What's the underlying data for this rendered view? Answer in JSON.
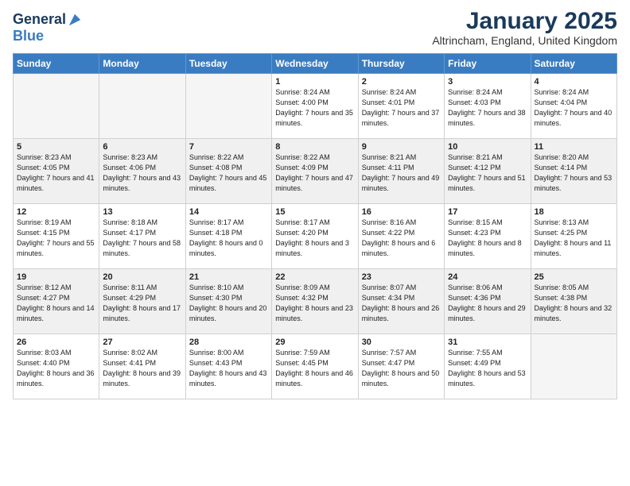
{
  "header": {
    "logo_general": "General",
    "logo_blue": "Blue",
    "month_title": "January 2025",
    "location": "Altrincham, England, United Kingdom"
  },
  "days_of_week": [
    "Sunday",
    "Monday",
    "Tuesday",
    "Wednesday",
    "Thursday",
    "Friday",
    "Saturday"
  ],
  "weeks": [
    [
      {
        "day": "",
        "sunrise": "",
        "sunset": "",
        "daylight": ""
      },
      {
        "day": "",
        "sunrise": "",
        "sunset": "",
        "daylight": ""
      },
      {
        "day": "",
        "sunrise": "",
        "sunset": "",
        "daylight": ""
      },
      {
        "day": "1",
        "sunrise": "Sunrise: 8:24 AM",
        "sunset": "Sunset: 4:00 PM",
        "daylight": "Daylight: 7 hours and 35 minutes."
      },
      {
        "day": "2",
        "sunrise": "Sunrise: 8:24 AM",
        "sunset": "Sunset: 4:01 PM",
        "daylight": "Daylight: 7 hours and 37 minutes."
      },
      {
        "day": "3",
        "sunrise": "Sunrise: 8:24 AM",
        "sunset": "Sunset: 4:03 PM",
        "daylight": "Daylight: 7 hours and 38 minutes."
      },
      {
        "day": "4",
        "sunrise": "Sunrise: 8:24 AM",
        "sunset": "Sunset: 4:04 PM",
        "daylight": "Daylight: 7 hours and 40 minutes."
      }
    ],
    [
      {
        "day": "5",
        "sunrise": "Sunrise: 8:23 AM",
        "sunset": "Sunset: 4:05 PM",
        "daylight": "Daylight: 7 hours and 41 minutes."
      },
      {
        "day": "6",
        "sunrise": "Sunrise: 8:23 AM",
        "sunset": "Sunset: 4:06 PM",
        "daylight": "Daylight: 7 hours and 43 minutes."
      },
      {
        "day": "7",
        "sunrise": "Sunrise: 8:22 AM",
        "sunset": "Sunset: 4:08 PM",
        "daylight": "Daylight: 7 hours and 45 minutes."
      },
      {
        "day": "8",
        "sunrise": "Sunrise: 8:22 AM",
        "sunset": "Sunset: 4:09 PM",
        "daylight": "Daylight: 7 hours and 47 minutes."
      },
      {
        "day": "9",
        "sunrise": "Sunrise: 8:21 AM",
        "sunset": "Sunset: 4:11 PM",
        "daylight": "Daylight: 7 hours and 49 minutes."
      },
      {
        "day": "10",
        "sunrise": "Sunrise: 8:21 AM",
        "sunset": "Sunset: 4:12 PM",
        "daylight": "Daylight: 7 hours and 51 minutes."
      },
      {
        "day": "11",
        "sunrise": "Sunrise: 8:20 AM",
        "sunset": "Sunset: 4:14 PM",
        "daylight": "Daylight: 7 hours and 53 minutes."
      }
    ],
    [
      {
        "day": "12",
        "sunrise": "Sunrise: 8:19 AM",
        "sunset": "Sunset: 4:15 PM",
        "daylight": "Daylight: 7 hours and 55 minutes."
      },
      {
        "day": "13",
        "sunrise": "Sunrise: 8:18 AM",
        "sunset": "Sunset: 4:17 PM",
        "daylight": "Daylight: 7 hours and 58 minutes."
      },
      {
        "day": "14",
        "sunrise": "Sunrise: 8:17 AM",
        "sunset": "Sunset: 4:18 PM",
        "daylight": "Daylight: 8 hours and 0 minutes."
      },
      {
        "day": "15",
        "sunrise": "Sunrise: 8:17 AM",
        "sunset": "Sunset: 4:20 PM",
        "daylight": "Daylight: 8 hours and 3 minutes."
      },
      {
        "day": "16",
        "sunrise": "Sunrise: 8:16 AM",
        "sunset": "Sunset: 4:22 PM",
        "daylight": "Daylight: 8 hours and 6 minutes."
      },
      {
        "day": "17",
        "sunrise": "Sunrise: 8:15 AM",
        "sunset": "Sunset: 4:23 PM",
        "daylight": "Daylight: 8 hours and 8 minutes."
      },
      {
        "day": "18",
        "sunrise": "Sunrise: 8:13 AM",
        "sunset": "Sunset: 4:25 PM",
        "daylight": "Daylight: 8 hours and 11 minutes."
      }
    ],
    [
      {
        "day": "19",
        "sunrise": "Sunrise: 8:12 AM",
        "sunset": "Sunset: 4:27 PM",
        "daylight": "Daylight: 8 hours and 14 minutes."
      },
      {
        "day": "20",
        "sunrise": "Sunrise: 8:11 AM",
        "sunset": "Sunset: 4:29 PM",
        "daylight": "Daylight: 8 hours and 17 minutes."
      },
      {
        "day": "21",
        "sunrise": "Sunrise: 8:10 AM",
        "sunset": "Sunset: 4:30 PM",
        "daylight": "Daylight: 8 hours and 20 minutes."
      },
      {
        "day": "22",
        "sunrise": "Sunrise: 8:09 AM",
        "sunset": "Sunset: 4:32 PM",
        "daylight": "Daylight: 8 hours and 23 minutes."
      },
      {
        "day": "23",
        "sunrise": "Sunrise: 8:07 AM",
        "sunset": "Sunset: 4:34 PM",
        "daylight": "Daylight: 8 hours and 26 minutes."
      },
      {
        "day": "24",
        "sunrise": "Sunrise: 8:06 AM",
        "sunset": "Sunset: 4:36 PM",
        "daylight": "Daylight: 8 hours and 29 minutes."
      },
      {
        "day": "25",
        "sunrise": "Sunrise: 8:05 AM",
        "sunset": "Sunset: 4:38 PM",
        "daylight": "Daylight: 8 hours and 32 minutes."
      }
    ],
    [
      {
        "day": "26",
        "sunrise": "Sunrise: 8:03 AM",
        "sunset": "Sunset: 4:40 PM",
        "daylight": "Daylight: 8 hours and 36 minutes."
      },
      {
        "day": "27",
        "sunrise": "Sunrise: 8:02 AM",
        "sunset": "Sunset: 4:41 PM",
        "daylight": "Daylight: 8 hours and 39 minutes."
      },
      {
        "day": "28",
        "sunrise": "Sunrise: 8:00 AM",
        "sunset": "Sunset: 4:43 PM",
        "daylight": "Daylight: 8 hours and 43 minutes."
      },
      {
        "day": "29",
        "sunrise": "Sunrise: 7:59 AM",
        "sunset": "Sunset: 4:45 PM",
        "daylight": "Daylight: 8 hours and 46 minutes."
      },
      {
        "day": "30",
        "sunrise": "Sunrise: 7:57 AM",
        "sunset": "Sunset: 4:47 PM",
        "daylight": "Daylight: 8 hours and 50 minutes."
      },
      {
        "day": "31",
        "sunrise": "Sunrise: 7:55 AM",
        "sunset": "Sunset: 4:49 PM",
        "daylight": "Daylight: 8 hours and 53 minutes."
      },
      {
        "day": "",
        "sunrise": "",
        "sunset": "",
        "daylight": ""
      }
    ]
  ]
}
